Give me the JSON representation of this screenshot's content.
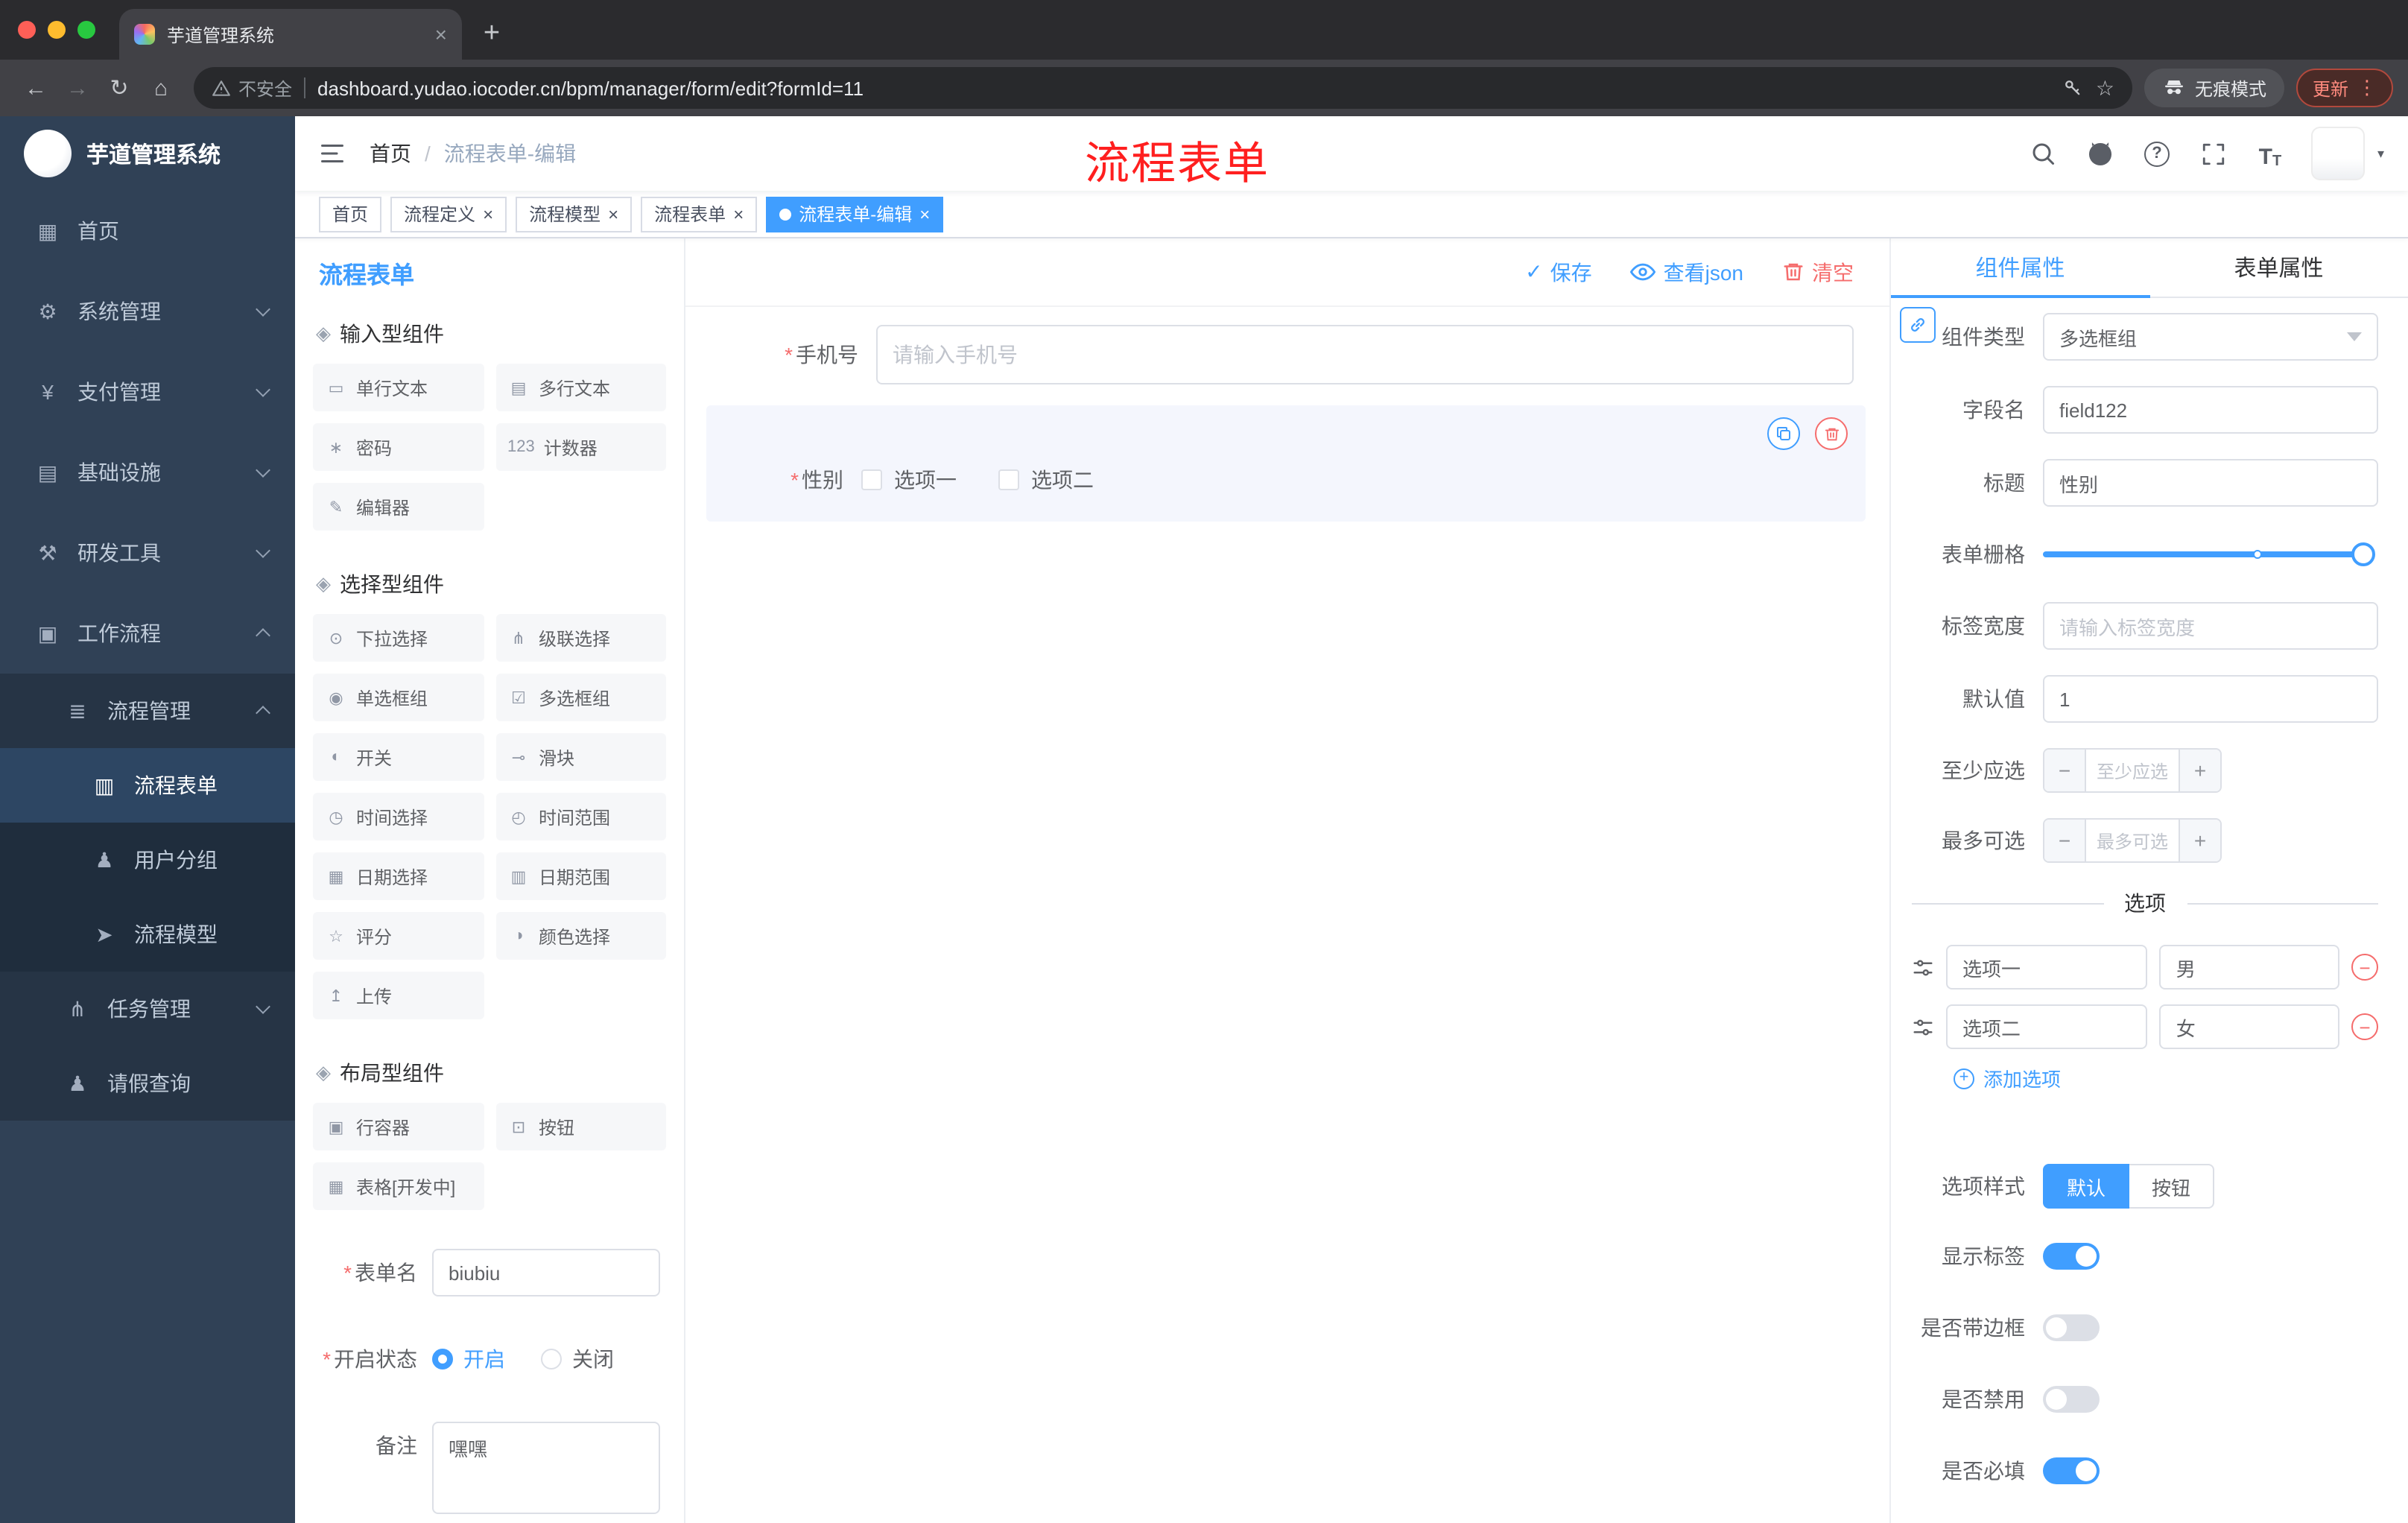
{
  "colors": {
    "accent": "#409eff",
    "danger": "#f56c6c",
    "annotation": "#ff1f1f",
    "sidebar_bg": "#304156"
  },
  "browser": {
    "tab_title": "芋道管理系统",
    "security_label": "不安全",
    "url": "dashboard.yudao.iocoder.cn/bpm/manager/form/edit?formId=11",
    "incognito_label": "无痕模式",
    "update_label": "更新"
  },
  "annotation": {
    "text": "流程表单"
  },
  "sidebar": {
    "logo_title": "芋道管理系统",
    "items": [
      {
        "icon": "▦",
        "label": "首页",
        "level": 0
      },
      {
        "icon": "⚙",
        "label": "系统管理",
        "level": 0,
        "chevron": "down"
      },
      {
        "icon": "¥",
        "label": "支付管理",
        "level": 0,
        "chevron": "down"
      },
      {
        "icon": "▤",
        "label": "基础设施",
        "level": 0,
        "chevron": "down"
      },
      {
        "icon": "⚒",
        "label": "研发工具",
        "level": 0,
        "chevron": "down"
      },
      {
        "icon": "▣",
        "label": "工作流程",
        "level": 0,
        "chevron": "up"
      },
      {
        "icon": "≣",
        "label": "流程管理",
        "level": 1,
        "chevron": "up"
      },
      {
        "icon": "▥",
        "label": "流程表单",
        "level": 2,
        "active": true
      },
      {
        "icon": "♟",
        "label": "用户分组",
        "level": 2
      },
      {
        "icon": "➤",
        "label": "流程模型",
        "level": 2
      },
      {
        "icon": "⋔",
        "label": "任务管理",
        "level": 1,
        "chevron": "down"
      },
      {
        "icon": "♟",
        "label": "请假查询",
        "level": 1
      }
    ]
  },
  "navbar": {
    "breadcrumb_home": "首页",
    "breadcrumb_sep": "/",
    "breadcrumb_current": "流程表单-编辑"
  },
  "tags": [
    {
      "label": "首页",
      "pinned": true
    },
    {
      "label": "流程定义"
    },
    {
      "label": "流程模型"
    },
    {
      "label": "流程表单"
    },
    {
      "label": "流程表单-编辑",
      "active": true
    }
  ],
  "designer": {
    "title": "流程表单",
    "actions": {
      "save": "保存",
      "view_json": "查看json",
      "clear": "清空"
    },
    "groups": {
      "input": {
        "title": "输入型组件",
        "items": [
          {
            "icon": "▭",
            "label": "单行文本"
          },
          {
            "icon": "▤",
            "label": "多行文本"
          },
          {
            "icon": "∗",
            "label": "密码"
          },
          {
            "icon": "123",
            "label": "计数器"
          },
          {
            "icon": "✎",
            "label": "编辑器"
          }
        ]
      },
      "select": {
        "title": "选择型组件",
        "items": [
          {
            "icon": "⊙",
            "label": "下拉选择"
          },
          {
            "icon": "⋔",
            "label": "级联选择"
          },
          {
            "icon": "◉",
            "label": "单选框组"
          },
          {
            "icon": "☑",
            "label": "多选框组"
          },
          {
            "icon": "◐",
            "label": "开关"
          },
          {
            "icon": "⊸",
            "label": "滑块"
          },
          {
            "icon": "◷",
            "label": "时间选择"
          },
          {
            "icon": "◴",
            "label": "时间范围"
          },
          {
            "icon": "▦",
            "label": "日期选择"
          },
          {
            "icon": "▥",
            "label": "日期范围"
          },
          {
            "icon": "☆",
            "label": "评分"
          },
          {
            "icon": "◑",
            "label": "颜色选择"
          },
          {
            "icon": "↥",
            "label": "上传"
          }
        ]
      },
      "layout": {
        "title": "布局型组件",
        "items": [
          {
            "icon": "▣",
            "label": "行容器"
          },
          {
            "icon": "⊡",
            "label": "按钮"
          },
          {
            "icon": "▦",
            "label": "表格[开发中]"
          }
        ]
      }
    },
    "form_config": {
      "name_label": "表单名",
      "name_value": "biubiu",
      "status_label": "开启状态",
      "status_on": "开启",
      "status_off": "关闭",
      "remark_label": "备注",
      "remark_value": "嘿嘿"
    },
    "canvas": {
      "phone_label": "手机号",
      "phone_placeholder": "请输入手机号",
      "gender_label": "性别",
      "gender_options": [
        {
          "label": "选项一"
        },
        {
          "label": "选项二"
        }
      ]
    },
    "properties": {
      "tab_component": "组件属性",
      "tab_form": "表单属性",
      "rows": {
        "type_label": "组件类型",
        "type_value": "多选框组",
        "field_label": "字段名",
        "field_value": "field122",
        "title_label": "标题",
        "title_value": "性别",
        "grid_label": "表单栅格",
        "labelwidth_label": "标签宽度",
        "labelwidth_placeholder": "请输入标签宽度",
        "default_label": "默认值",
        "default_value": "1",
        "min_label": "至少应选",
        "min_placeholder": "至少应选",
        "max_label": "最多可选",
        "max_placeholder": "最多可选"
      },
      "options_title": "选项",
      "options": [
        {
          "label": "选项一",
          "value": "男"
        },
        {
          "label": "选项二",
          "value": "女"
        }
      ],
      "add_option": "添加选项",
      "style_label": "选项样式",
      "style_options": [
        {
          "label": "默认",
          "active": true
        },
        {
          "label": "按钮"
        }
      ],
      "switches": [
        {
          "label": "显示标签",
          "on": true
        },
        {
          "label": "是否带边框"
        },
        {
          "label": "是否禁用"
        },
        {
          "label": "是否必填",
          "on": true
        }
      ]
    }
  }
}
